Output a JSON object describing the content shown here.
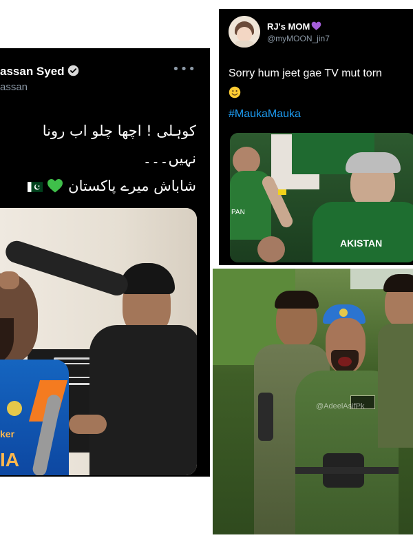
{
  "left_tweet": {
    "author_name": "assan Syed",
    "author_handle": "assan",
    "more_icon": "more-dots-icon",
    "verified_icon": "verified-badge-icon",
    "text_line1": "کوہلی ! اچھا چلو اب رونا نہیں۔۔۔",
    "text_line2": "شاباش میرے پاکستان",
    "emoji_heart": "green-heart-icon",
    "emoji_flag": "pakistan-flag-icon",
    "photo_jersey_text": "ker",
    "photo_jersey_text2": "IA"
  },
  "right_tweet": {
    "author_name": "RJ's MOM",
    "name_heart": "purple-heart-icon",
    "author_handle": "@myMOON_jin7",
    "text": "Sorry hum jeet gae TV mut torn",
    "emoji_smile": "slightly-smiling-face-icon",
    "hashtag": "#MaukaMauka",
    "photo_jersey_text": "AKISTAN",
    "photo_banner_text": "PAN"
  },
  "bottom_photo": {
    "watermark": "@AdeelAsifPk"
  },
  "colors": {
    "tweet_bg": "#000000",
    "hashtag": "#1d9bf0",
    "handle": "#8b98a5",
    "verified": "#d9d9d9",
    "green_heart": "#3fbf4a",
    "purple_heart": "#a35dd8"
  }
}
